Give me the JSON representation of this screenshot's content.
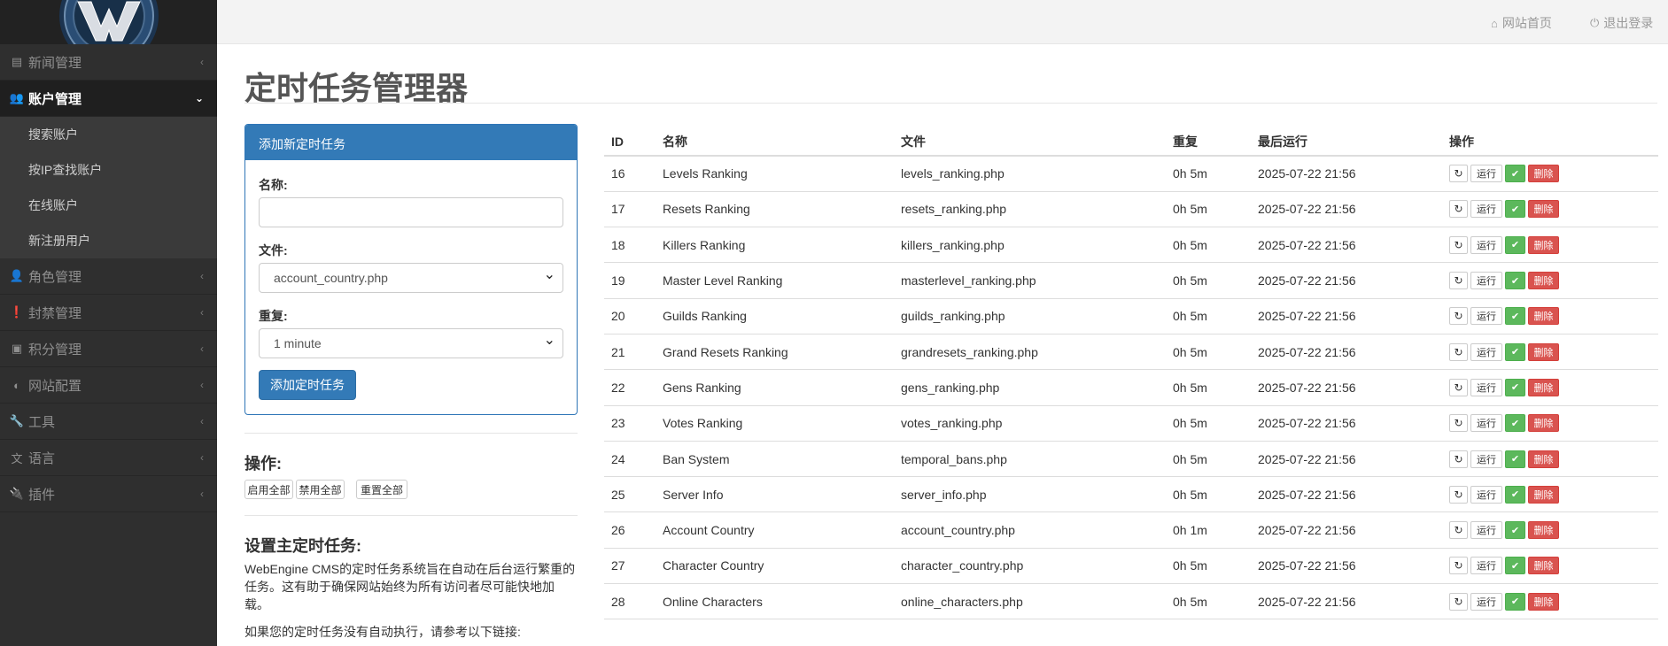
{
  "colors": {
    "primary": "#337ab7",
    "success": "#5cb85c",
    "danger": "#d9534f",
    "sidebar": "#2f2f2f"
  },
  "sidebar": {
    "items": [
      {
        "label": "新闻管理",
        "icon": "newspaper-icon"
      },
      {
        "label": "账户管理",
        "icon": "users-icon",
        "active": true,
        "subitems": [
          "搜索账户",
          "按IP查找账户",
          "在线账户",
          "新注册用户"
        ]
      },
      {
        "label": "角色管理",
        "icon": "user-icon"
      },
      {
        "label": "封禁管理",
        "icon": "exclamation-icon"
      },
      {
        "label": "积分管理",
        "icon": "money-icon"
      },
      {
        "label": "网站配置",
        "icon": "toggle-icon"
      },
      {
        "label": "工具",
        "icon": "wrench-icon"
      },
      {
        "label": "语言",
        "icon": "language-icon"
      },
      {
        "label": "插件",
        "icon": "plug-icon"
      }
    ]
  },
  "topbar": {
    "home": "网站首页",
    "logout": "退出登录"
  },
  "page": {
    "title": "定时任务管理器"
  },
  "form": {
    "header": "添加新定时任务",
    "name_label": "名称:",
    "name_value": "",
    "file_label": "文件:",
    "file_value": "account_country.php",
    "repeat_label": "重复:",
    "repeat_value": "1 minute",
    "submit": "添加定时任务"
  },
  "actions": {
    "title": "操作:",
    "enable_all": "启用全部",
    "disable_all": "禁用全部",
    "reset_all": "重置全部"
  },
  "setup": {
    "title": "设置主定时任务:",
    "desc": "WebEngine CMS的定时任务系统旨在自动在后台运行繁重的任务。这有助于确保网站始终为所有访问者尽可能快地加载。",
    "note": "如果您的定时任务没有自动执行，请参考以下链接:"
  },
  "table": {
    "headers": {
      "id": "ID",
      "name": "名称",
      "file": "文件",
      "repeat": "重复",
      "last_run": "最后运行",
      "actions": "操作"
    },
    "run_label": "运行",
    "delete_label": "删除",
    "rows": [
      {
        "id": "16",
        "name": "Levels Ranking",
        "file": "levels_ranking.php",
        "repeat": "0h 5m",
        "last_run": "2025-07-22 21:56"
      },
      {
        "id": "17",
        "name": "Resets Ranking",
        "file": "resets_ranking.php",
        "repeat": "0h 5m",
        "last_run": "2025-07-22 21:56"
      },
      {
        "id": "18",
        "name": "Killers Ranking",
        "file": "killers_ranking.php",
        "repeat": "0h 5m",
        "last_run": "2025-07-22 21:56"
      },
      {
        "id": "19",
        "name": "Master Level Ranking",
        "file": "masterlevel_ranking.php",
        "repeat": "0h 5m",
        "last_run": "2025-07-22 21:56"
      },
      {
        "id": "20",
        "name": "Guilds Ranking",
        "file": "guilds_ranking.php",
        "repeat": "0h 5m",
        "last_run": "2025-07-22 21:56"
      },
      {
        "id": "21",
        "name": "Grand Resets Ranking",
        "file": "grandresets_ranking.php",
        "repeat": "0h 5m",
        "last_run": "2025-07-22 21:56"
      },
      {
        "id": "22",
        "name": "Gens Ranking",
        "file": "gens_ranking.php",
        "repeat": "0h 5m",
        "last_run": "2025-07-22 21:56"
      },
      {
        "id": "23",
        "name": "Votes Ranking",
        "file": "votes_ranking.php",
        "repeat": "0h 5m",
        "last_run": "2025-07-22 21:56"
      },
      {
        "id": "24",
        "name": "Ban System",
        "file": "temporal_bans.php",
        "repeat": "0h 5m",
        "last_run": "2025-07-22 21:56"
      },
      {
        "id": "25",
        "name": "Server Info",
        "file": "server_info.php",
        "repeat": "0h 5m",
        "last_run": "2025-07-22 21:56"
      },
      {
        "id": "26",
        "name": "Account Country",
        "file": "account_country.php",
        "repeat": "0h 1m",
        "last_run": "2025-07-22 21:56"
      },
      {
        "id": "27",
        "name": "Character Country",
        "file": "character_country.php",
        "repeat": "0h 5m",
        "last_run": "2025-07-22 21:56"
      },
      {
        "id": "28",
        "name": "Online Characters",
        "file": "online_characters.php",
        "repeat": "0h 5m",
        "last_run": "2025-07-22 21:56"
      }
    ]
  }
}
